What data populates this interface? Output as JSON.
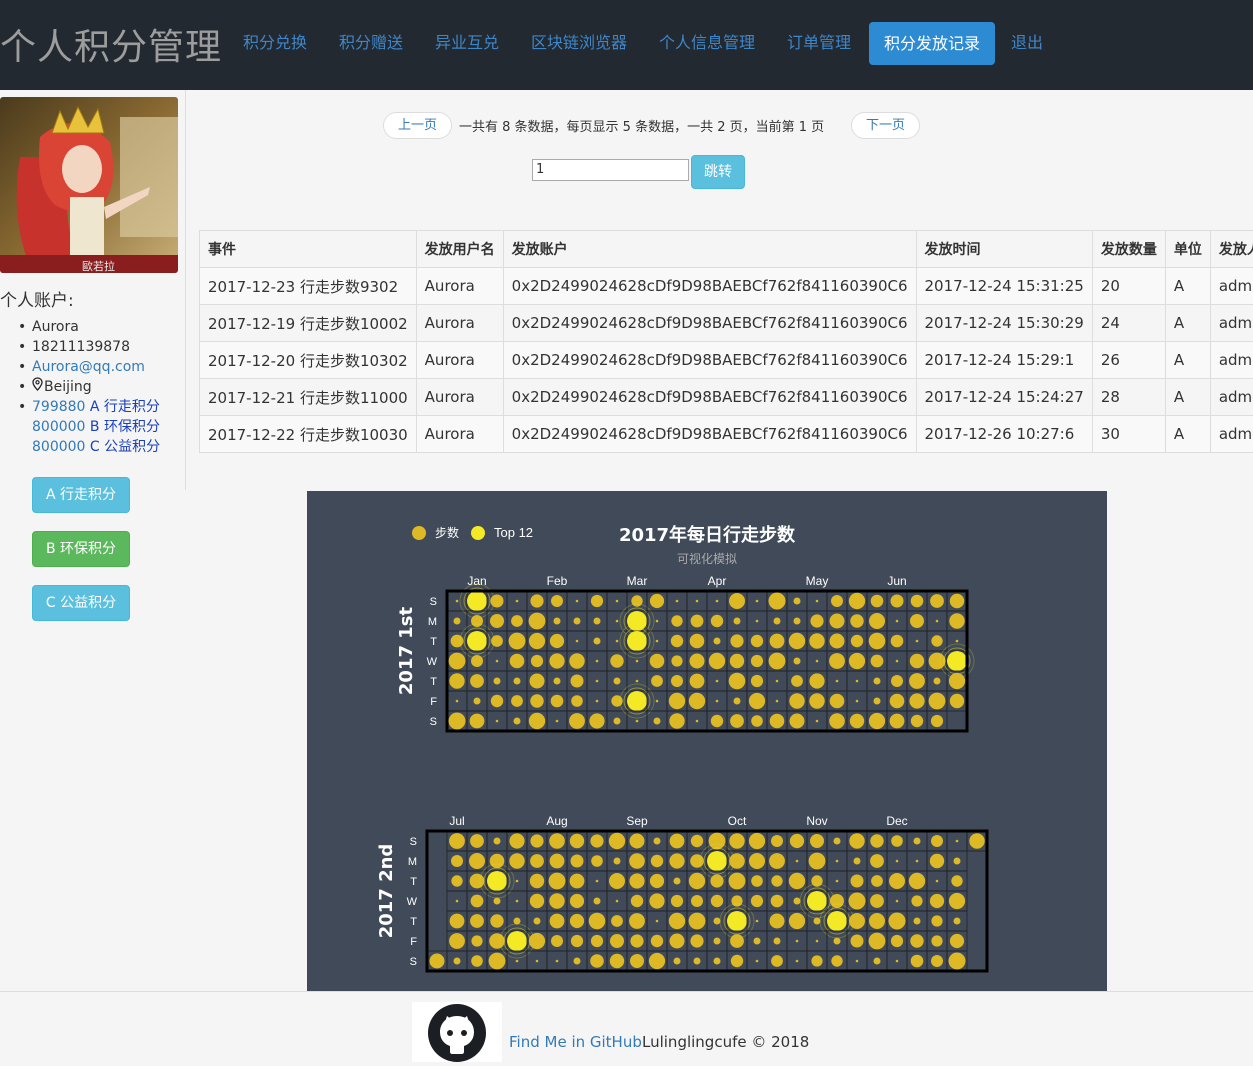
{
  "nav": {
    "brand": "个人积分管理",
    "items": [
      "积分兑换",
      "积分赠送",
      "异业互兑",
      "区块链浏览器",
      "个人信息管理",
      "订单管理"
    ],
    "active": "积分发放记录",
    "logout": "退出"
  },
  "sidebar": {
    "avatar_caption": "歐若拉",
    "account_title": "个人账户:",
    "name": "Aurora",
    "phone": "18211139878",
    "email": "Aurora@qq.com",
    "location": "Beijing",
    "points": [
      {
        "amount": "799880",
        "label": "A 行走积分"
      },
      {
        "amount": "800000",
        "label": "B 环保积分"
      },
      {
        "amount": "800000",
        "label": "C 公益积分"
      }
    ],
    "buttons": [
      "A 行走积分",
      "B 环保积分",
      "C 公益积分"
    ]
  },
  "pager": {
    "prev": "上一页",
    "info": "一共有 8 条数据，每页显示 5 条数据，一共 2 页，当前第 1 页",
    "next": "下一页",
    "jump_value": "1",
    "jump_button": "跳转"
  },
  "table": {
    "headers": [
      "事件",
      "发放用户名",
      "发放账户",
      "发放时间",
      "发放数量",
      "单位",
      "发放人"
    ],
    "rows": [
      [
        "2017-12-23 行走步数9302",
        "Aurora",
        "0x2D2499024628cDf9D98BAEBCf762f841160390C6",
        "2017-12-24 15:31:25",
        "20",
        "A",
        "admin"
      ],
      [
        "2017-12-19 行走步数10002",
        "Aurora",
        "0x2D2499024628cDf9D98BAEBCf762f841160390C6",
        "2017-12-24 15:30:29",
        "24",
        "A",
        "admin"
      ],
      [
        "2017-12-20 行走步数10302",
        "Aurora",
        "0x2D2499024628cDf9D98BAEBCf762f841160390C6",
        "2017-12-24 15:29:1",
        "26",
        "A",
        "admin"
      ],
      [
        "2017-12-21 行走步数11000",
        "Aurora",
        "0x2D2499024628cDf9D98BAEBCf762f841160390C6",
        "2017-12-24 15:24:27",
        "28",
        "A",
        "admin"
      ],
      [
        "2017-12-22 行走步数10030",
        "Aurora",
        "0x2D2499024628cDf9D98BAEBCf762f841160390C6",
        "2017-12-26 10:27:6",
        "30",
        "A",
        "admin"
      ]
    ]
  },
  "chart_data": {
    "type": "heatmap",
    "title": "2017年每日行走步数",
    "subtitle": "可视化模拟",
    "legend": [
      "步数",
      "Top 12"
    ],
    "legend_position": "top-left",
    "background": "#404a59",
    "dot_color": "#ddb926",
    "top_color": "#f4e925",
    "weekday_labels": [
      "S",
      "M",
      "T",
      "W",
      "T",
      "F",
      "S"
    ],
    "calendars": [
      {
        "label": "2017 1st",
        "months": [
          "Jan",
          "Feb",
          "Mar",
          "Apr",
          "May",
          "Jun"
        ],
        "range": [
          "2017-01-01",
          "2017-06-30"
        ]
      },
      {
        "label": "2017 2nd",
        "months": [
          "Jul",
          "Aug",
          "Sep",
          "Oct",
          "Nov",
          "Dec"
        ],
        "range": [
          "2017-07-01",
          "2017-12-31"
        ]
      }
    ],
    "top12": [
      "2017-01-08",
      "2017-01-10",
      "2017-03-06",
      "2017-03-07",
      "2017-03-10",
      "2017-06-28",
      "2017-07-18",
      "2017-07-28",
      "2017-10-02",
      "2017-10-12",
      "2017-11-08",
      "2017-11-16"
    ]
  },
  "footer": {
    "github_link": "Find Me in GitHub",
    "copyright": "Lulinglingcufe © 2018"
  }
}
